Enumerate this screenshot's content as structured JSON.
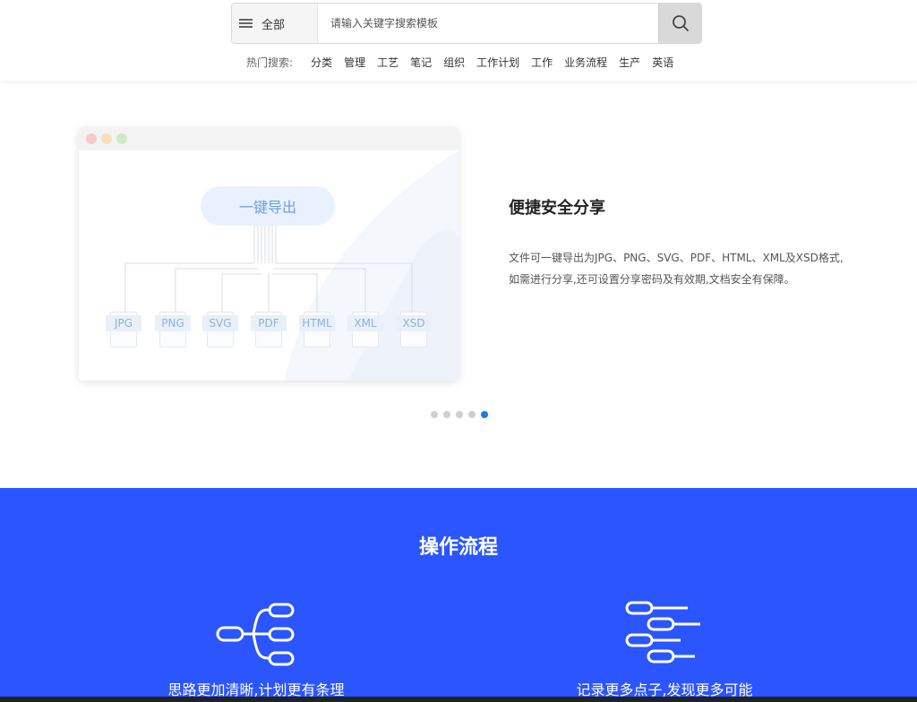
{
  "search": {
    "category_label": "全部",
    "placeholder": "请输入关键字搜索模板",
    "value": ""
  },
  "hot": {
    "label": "热门搜索:",
    "tags": [
      "分类",
      "管理",
      "工艺",
      "笔记",
      "组织",
      "工作计划",
      "工作",
      "业务流程",
      "生产",
      "英语"
    ]
  },
  "feature": {
    "illustration_button": "一键导出",
    "formats": [
      "JPG",
      "PNG",
      "SVG",
      "PDF",
      "HTML",
      "XML",
      "XSD"
    ],
    "title": "便捷安全分享",
    "desc_line1": "文件可一键导出为JPG、PNG、SVG、PDF、HTML、XML及XSD格式,",
    "desc_line2": "如需进行分享,还可设置分享密码及有效期,文档安全有保障。"
  },
  "carousel": {
    "count": 5,
    "active_index": 4
  },
  "process": {
    "title": "操作流程",
    "items": [
      {
        "icon": "mindmap-icon",
        "caption": "思路更加清晰,计划更有条理"
      },
      {
        "icon": "outline-icon",
        "caption": "记录更多点子,发现更多可能"
      }
    ]
  },
  "colors": {
    "accent_blue": "#2b55fe",
    "active_dot": "#1e7ae6"
  }
}
